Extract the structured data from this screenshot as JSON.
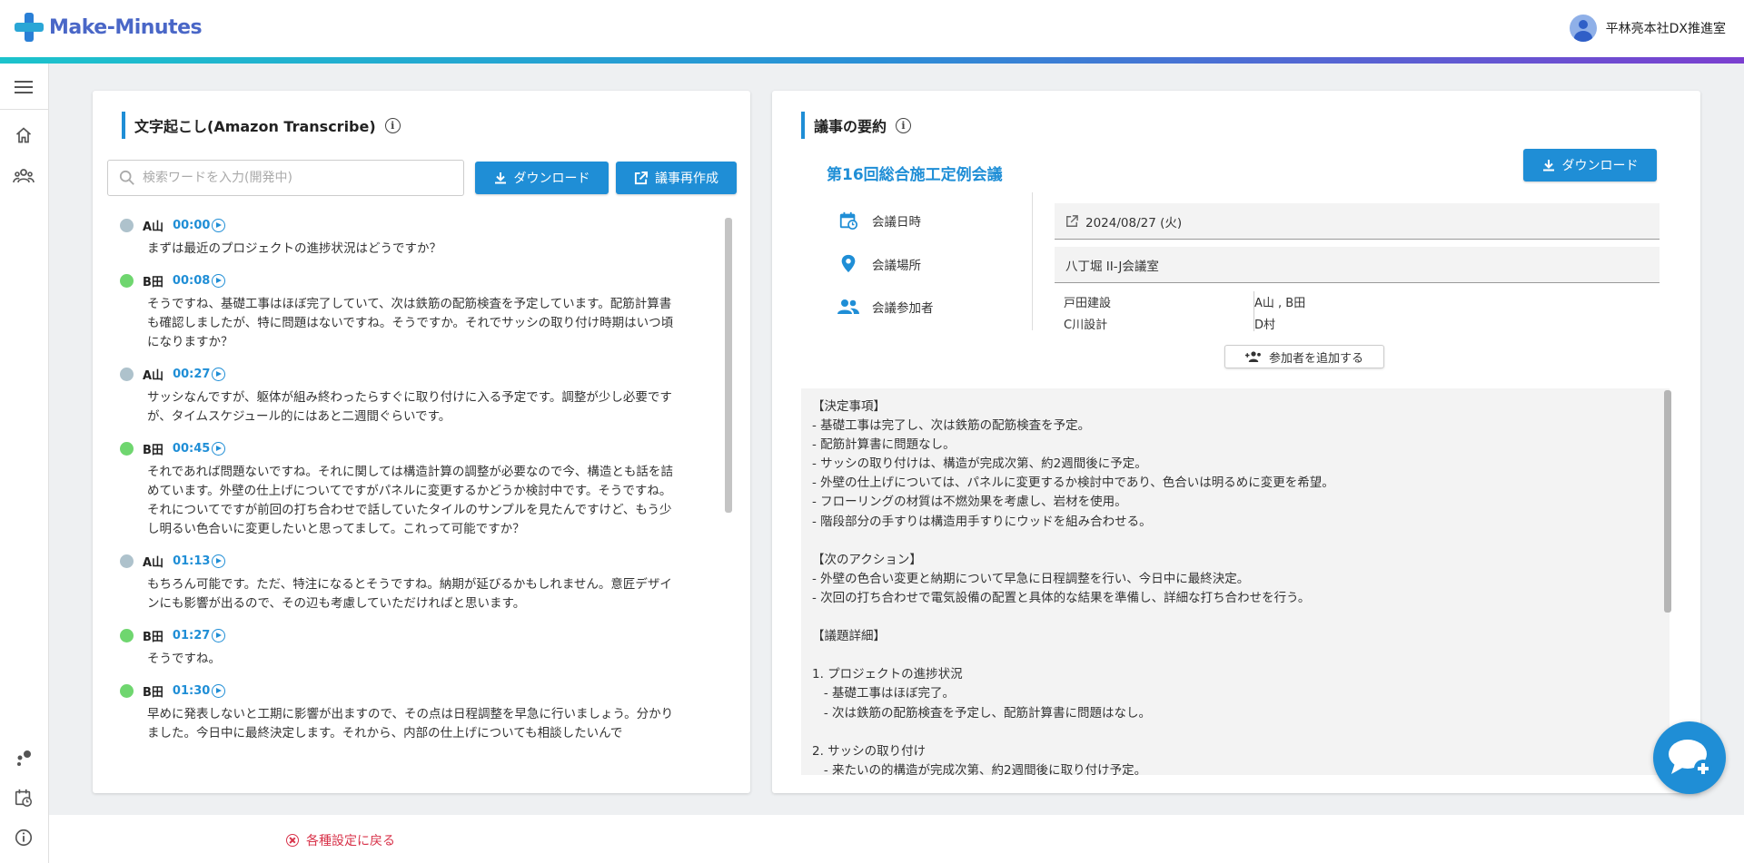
{
  "app": {
    "name": "Make-Minutes",
    "user_name": "平林亮本社DX推進室"
  },
  "left_panel": {
    "title": "文字起こし(Amazon Transcribe)",
    "search_placeholder": "検索ワードを入力(開発中)",
    "download_label": "ダウンロード",
    "regenerate_label": "議事再作成",
    "transcript": [
      {
        "speaker": "A山",
        "time": "00:00",
        "color": "gray",
        "text": "まずは最近のプロジェクトの進捗状況はどうですか？"
      },
      {
        "speaker": "B田",
        "time": "00:08",
        "color": "green",
        "text": "そうですね、基礎工事はほぼ完了していて、次は鉄筋の配筋検査を予定しています。配筋計算書も確認しましたが、特に問題はないですね。そうですか。それでサッシの取り付け時期はいつ頃になりますか？"
      },
      {
        "speaker": "A山",
        "time": "00:27",
        "color": "gray",
        "text": "サッシなんですが、躯体が組み終わったらすぐに取り付けに入る予定です。調整が少し必要ですが、タイムスケジュール的にはあと二週間ぐらいです。"
      },
      {
        "speaker": "B田",
        "time": "00:45",
        "color": "green",
        "text": "それであれば問題ないですね。それに関しては構造計算の調整が必要なので今、構造とも話を詰めています。外壁の仕上げについてですがパネルに変更するかどうか検討中です。そうですね。それについてですが前回の打ち合わせで話していたタイルのサンプルを見たんですけど、もう少し明るい色合いに変更したいと思ってまして。これって可能ですか？"
      },
      {
        "speaker": "A山",
        "time": "01:13",
        "color": "gray",
        "text": "もちろん可能です。ただ、特注になるとそうですね。納期が延びるかもしれません。意匠デザインにも影響が出るので、その辺も考慮していただければと思います。"
      },
      {
        "speaker": "B田",
        "time": "01:27",
        "color": "green",
        "text": "そうですね。"
      },
      {
        "speaker": "B田",
        "time": "01:30",
        "color": "green",
        "text": "早めに発表しないと工期に影響が出ますので、その点は日程調整を早急に行いましょう。分かりました。今日中に最終決定します。それから、内部の仕上げについても相談したいんで"
      }
    ]
  },
  "right_panel": {
    "title": "議事の要約",
    "download_label": "ダウンロード",
    "meeting_title": "第16回総合施工定例会議",
    "date_label": "会議日時",
    "date_value": "2024/08/27 (火)",
    "place_label": "会議場所",
    "place_value": "八丁堀 II-J会議室",
    "participants_label": "会議参加者",
    "participants": [
      {
        "company": "戸田建設",
        "people": "A山 , B田"
      },
      {
        "company": "C川設計",
        "people": "D村"
      }
    ],
    "add_participant_label": "参加者を追加する",
    "summary": "【決定事項】\n- 基礎工事は完了し、次は鉄筋の配筋検査を予定。\n- 配筋計算書に問題なし。\n- サッシの取り付けは、構造が完成次第、約2週間後に予定。\n- 外壁の仕上げについては、パネルに変更するか検討中であり、色合いは明るめに変更を希望。\n- フローリングの材質は不燃効果を考慮し、岩材を使用。\n- 階段部分の手すりは構造用手すりにウッドを組み合わせる。\n\n【次のアクション】\n- 外壁の色合い変更と納期について早急に日程調整を行い、今日中に最終決定。\n- 次回の打ち合わせで電気設備の配置と具体的な結果を準備し、詳細な打ち合わせを行う。\n\n【議題詳細】\n\n1. プロジェクトの進捗状況\n   - 基礎工事はほぼ完了。\n   - 次は鉄筋の配筋検査を予定し、配筋計算書に問題はなし。\n\n2. サッシの取り付け\n   - 来たいの的構造が完成次第、約2週間後に取り付け予定。"
  },
  "footer": {
    "back_label": "各種設定に戻る"
  },
  "colors": {
    "accent": "#1f8ed6",
    "danger": "#d8334a",
    "speaker_a": "#aec2cc",
    "speaker_b": "#6fd66f"
  }
}
